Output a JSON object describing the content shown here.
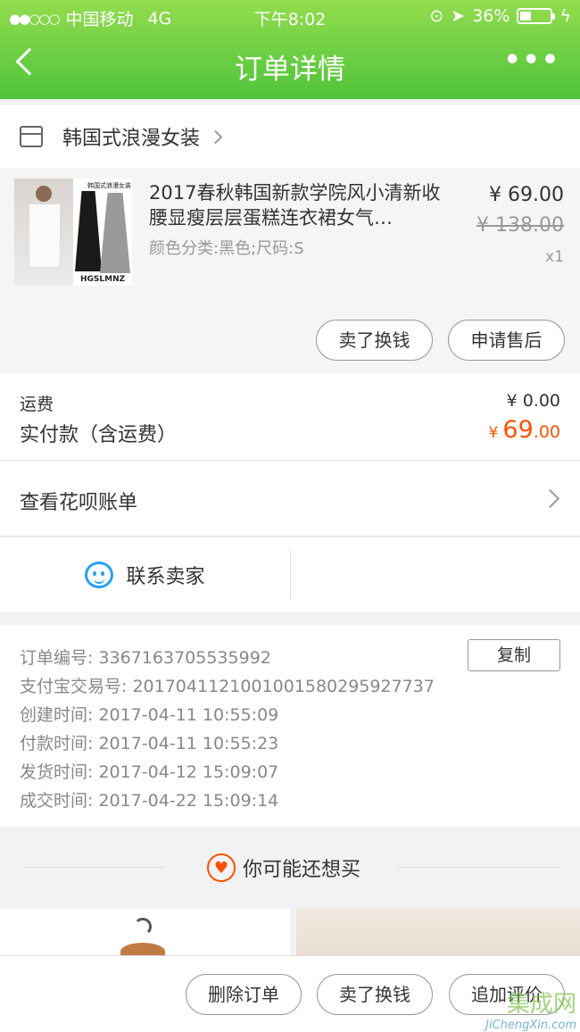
{
  "status_bar": {
    "signal_dots": "●●○○○",
    "carrier": "中国移动",
    "network": "4G",
    "time": "下午8:02",
    "battery_text": "36%",
    "battery_level": 0.36
  },
  "nav": {
    "title": "订单详情",
    "more_icon": "•••"
  },
  "shop": {
    "name": "韩国式浪漫女装"
  },
  "product": {
    "image_brand": "HGSLMNZ",
    "image_tag": "韩国式浪漫女装",
    "title": "2017春秋韩国新款学院风小清新收腰显瘦层层蛋糕连衣裙女气…",
    "sku": "颜色分类:黑色;尺码:S",
    "price": "¥ 69.00",
    "original_price": "¥ 138.00",
    "quantity": "x1",
    "sell_button": "卖了换钱",
    "after_sale_button": "申请售后"
  },
  "fees": {
    "shipping_label": "运费",
    "shipping_value": "¥ 0.00",
    "paid_label": "实付款（含运费）",
    "paid_currency": "¥",
    "paid_int": "69",
    "paid_dec": ".00"
  },
  "huabei": {
    "label": "查看花呗账单"
  },
  "contact": {
    "label": "联系卖家"
  },
  "order_info": {
    "copy_button": "复制",
    "rows": [
      {
        "key": "订单编号:",
        "value": "3367163705535992"
      },
      {
        "key": "支付宝交易号:",
        "value": "2017041121001001580295927737"
      },
      {
        "key": "创建时间:",
        "value": "2017-04-11 10:55:09"
      },
      {
        "key": "付款时间:",
        "value": "2017-04-11 10:55:23"
      },
      {
        "key": "发货时间:",
        "value": "2017-04-12 15:09:07"
      },
      {
        "key": "成交时间:",
        "value": "2017-04-22 15:09:14"
      }
    ]
  },
  "recommend": {
    "title": "你可能还想买"
  },
  "bottom_bar": {
    "delete_button": "删除订单",
    "sell_button": "卖了换钱",
    "review_button": "追加评价"
  },
  "watermark": {
    "logo": "集成网",
    "text": "JiChengXin.com"
  },
  "colors": {
    "header_top": "#93dd4e",
    "header_bottom": "#4fc33b",
    "price_accent": "#ff5000",
    "wangwang_blue": "#2aa1f4"
  }
}
